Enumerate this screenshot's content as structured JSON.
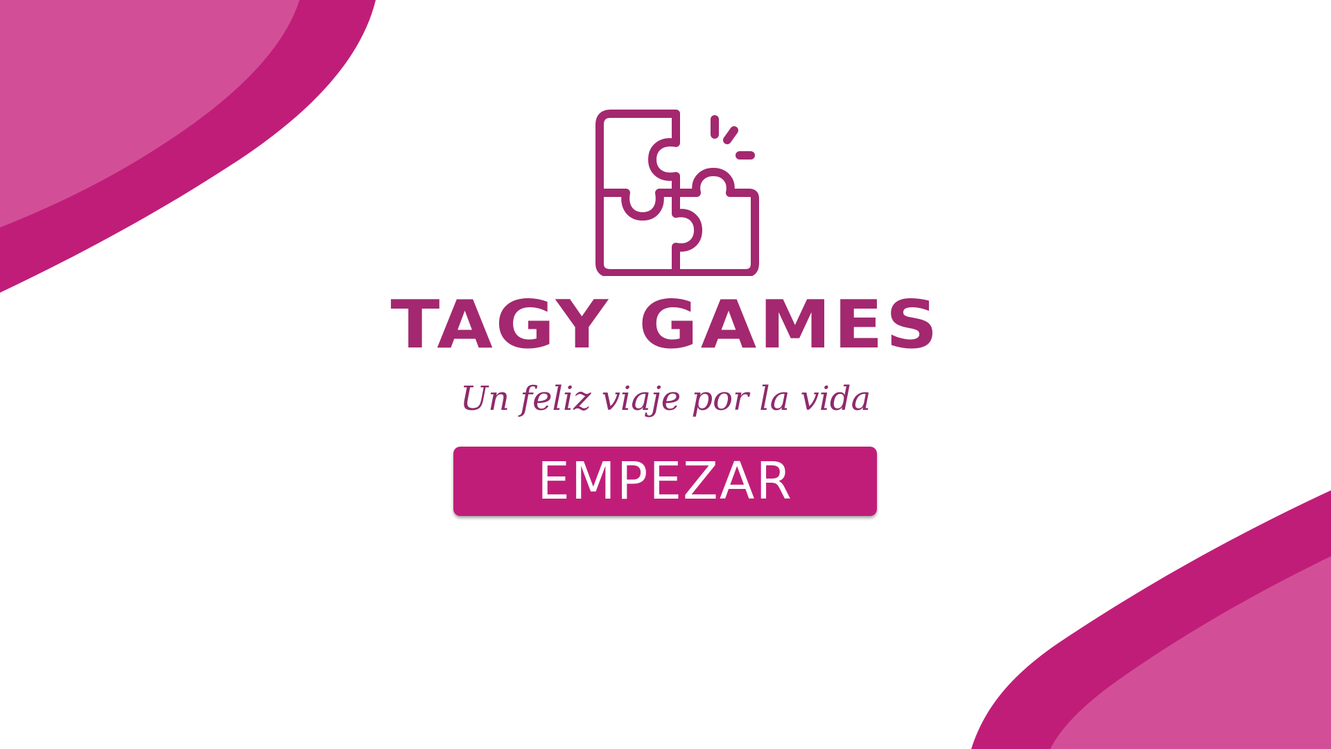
{
  "brand": {
    "logo_icon": "puzzle-icon",
    "title": "TAGY GAMES",
    "tagline": "Un feliz viaje por la vida"
  },
  "actions": {
    "start_label": "EMPEZAR"
  },
  "colors": {
    "accent_dark": "#c01d79",
    "accent_light": "#d24f97",
    "logo": "#a3286f",
    "background": "#ffffff"
  }
}
